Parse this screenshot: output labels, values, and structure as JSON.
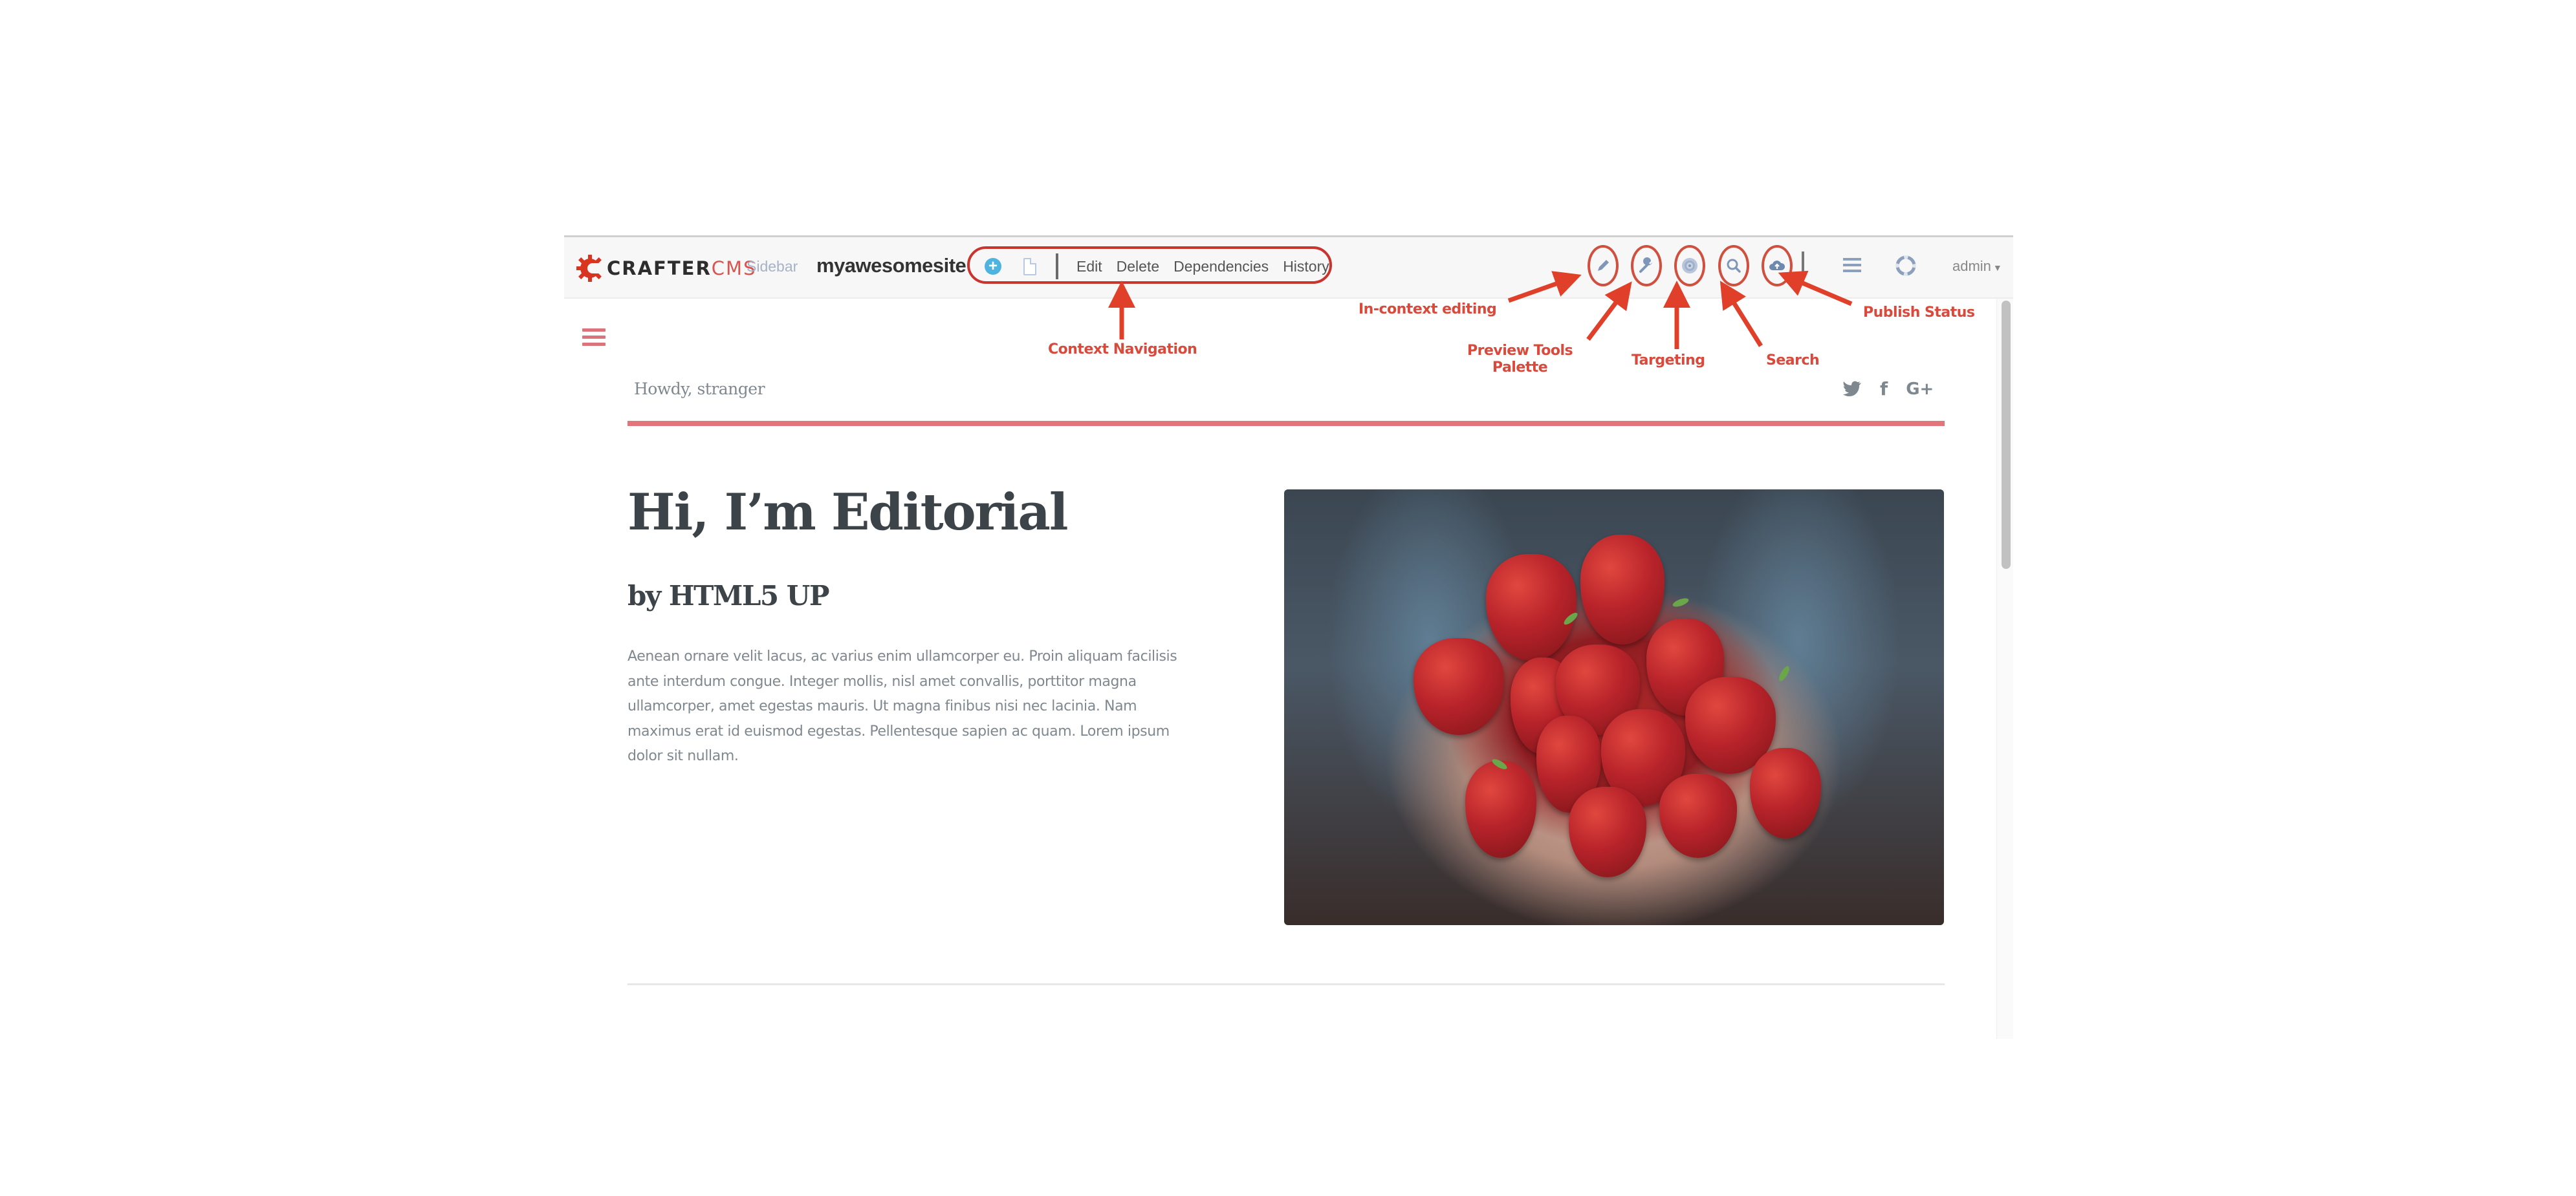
{
  "toolbar": {
    "logo_crafter": "CRAFTER",
    "logo_cms": "CMS",
    "sidebar_label": "Sidebar",
    "site_name": "myawesomesite",
    "context_nav": {
      "add_icon": "plus-circle-icon",
      "page_icon": "file-icon",
      "links": [
        "Edit",
        "Delete",
        "Dependencies",
        "History"
      ]
    },
    "tools": [
      {
        "name": "in-context-editing",
        "icon": "pencil-icon"
      },
      {
        "name": "preview-tools-palette",
        "icon": "wrench-icon"
      },
      {
        "name": "targeting",
        "icon": "target-icon"
      },
      {
        "name": "search",
        "icon": "search-icon"
      },
      {
        "name": "publish-status",
        "icon": "cloud-upload-icon"
      }
    ],
    "menu_icon": "hamburger-icon",
    "help_icon": "life-ring-icon",
    "user_label": "admin"
  },
  "annotations": {
    "context_navigation": "Context Navigation",
    "in_context_editing": "In-context editing",
    "preview_tools_line1": "Preview Tools",
    "preview_tools_line2": "Palette",
    "targeting": "Targeting",
    "search": "Search",
    "publish_status": "Publish Status",
    "accent_color": "#d9493c"
  },
  "page": {
    "greeting": "Howdy, stranger",
    "social_icons": [
      "twitter-icon",
      "facebook-icon",
      "google-plus-icon"
    ],
    "social_glyphs": {
      "facebook": "f",
      "google_plus": "G+"
    },
    "headline": "Hi, I’m Editorial",
    "subheadline": "by HTML5 UP",
    "paragraph_lines": [
      "Aenean ornare velit lacus, ac varius enim ullamcorper eu. Proin aliquam facilisis",
      "ante interdum congue. Integer mollis, nisl amet convallis, porttitor magna",
      "ullamcorper, amet egestas mauris. Ut magna finibus nisi nec lacinia. Nam",
      "maximus erat id euismod egestas. Pellentesque sapien ac quam. Lorem ipsum",
      "dolor sit nullam."
    ],
    "hero_image_alt": "Hands holding strawberries",
    "accent_color": "#e2757b"
  }
}
